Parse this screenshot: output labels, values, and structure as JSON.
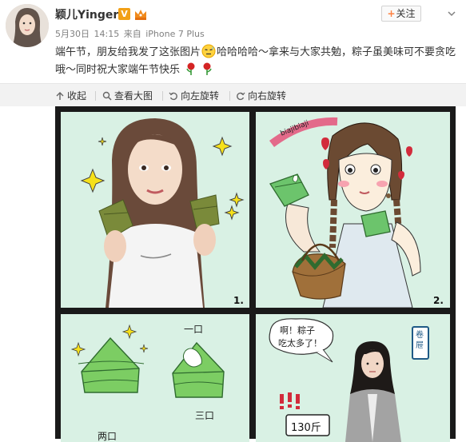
{
  "user": {
    "name": "颖儿Yinger",
    "verified_mark": "V"
  },
  "meta": {
    "date": "5月30日",
    "time": "14:15",
    "from_label": "来自",
    "device": "iPhone 7 Plus"
  },
  "follow_button": {
    "label": "关注",
    "plus": "+"
  },
  "post": {
    "text_part1": "端午节，朋友给我发了这张图片",
    "text_part2": "哈哈哈哈～拿来与大家共勉，粽子虽美味可不要贪吃哦～同时祝大家端午节快乐"
  },
  "toolbar": {
    "collapse": "收起",
    "view_large": "查看大图",
    "rotate_left": "向左旋转",
    "rotate_right": "向右旋转"
  },
  "comic": {
    "panel1_number": "1.",
    "panel2_number": "2.",
    "panel2_text": "biajibiaji",
    "panel3_top_text": "一口",
    "panel3_mid_text": "三口",
    "panel3_bottom_text": "两口",
    "panel4_bubble_line1": "啊！粽子",
    "panel4_bubble_line2": "吃太多了！",
    "panel4_exclaim": "!!!",
    "panel4_scale": "130斤",
    "panel4_sign": "卷屉"
  },
  "colors": {
    "panel_bg": "#d9f1e4",
    "zongzi_green": "#5cb85c",
    "follow_plus": "#ff8140",
    "verified_badge": "#f2a016"
  }
}
